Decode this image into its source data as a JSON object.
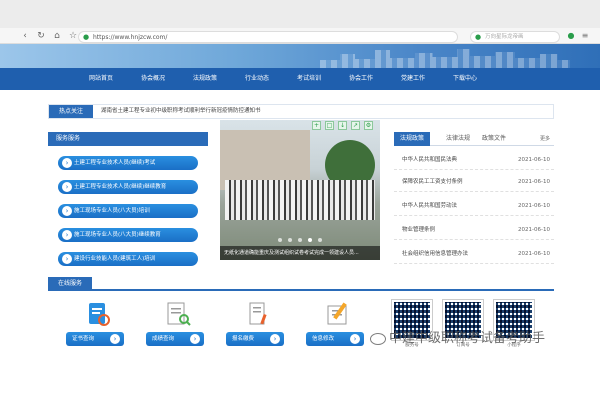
{
  "browser": {
    "url": "https://www.hnjzcw.com/",
    "search_placeholder": "万向星际龙帝画"
  },
  "nav": {
    "items": [
      "网站首页",
      "协会概况",
      "法规政策",
      "行业动态",
      "考试培训",
      "协会工作",
      "党建工作",
      "下载中心"
    ],
    "active": "网站首页"
  },
  "notice": {
    "tag": "热点关注",
    "text": "湖南省土建工程专业初中级职称考试顺利举行新冠疫情防控通知书"
  },
  "services": {
    "title": "服务服务",
    "items": [
      "土建工程专业技术人员(继续)考试",
      "土建工程专业技术人员(继续)继续教育",
      "施工现场专业人员(八大员)培训",
      "施工现场专业人员(八大员)继续教育",
      "建设行业技能人员(建筑工人)培训"
    ]
  },
  "photo": {
    "caption": "无纸化通道确能重庆及测试组织试卷考试完成一领建设人员..."
  },
  "laws": {
    "tabs": [
      "法规政策",
      "法律法规",
      "政策文件"
    ],
    "more": "更多",
    "rows": [
      {
        "title": "中华人民共和国民法典",
        "date": "2021-06-10"
      },
      {
        "title": "保障农民工工资支付条例",
        "date": "2021-06-10"
      },
      {
        "title": "中华人民共和国劳动法",
        "date": "2021-06-10"
      },
      {
        "title": "物业管理条例",
        "date": "2021-06-10"
      },
      {
        "title": "社会组织信用信息管理办法",
        "date": "2021-06-10"
      }
    ]
  },
  "online": {
    "title": "在线服务",
    "items": [
      "证书查询",
      "成绩查询",
      "报名缴费",
      "信息修改"
    ]
  },
  "qr": {
    "labels": [
      "服务号",
      "订阅号",
      "小程序"
    ]
  },
  "watermark": {
    "text": "中建中级职称考试备考助手"
  }
}
